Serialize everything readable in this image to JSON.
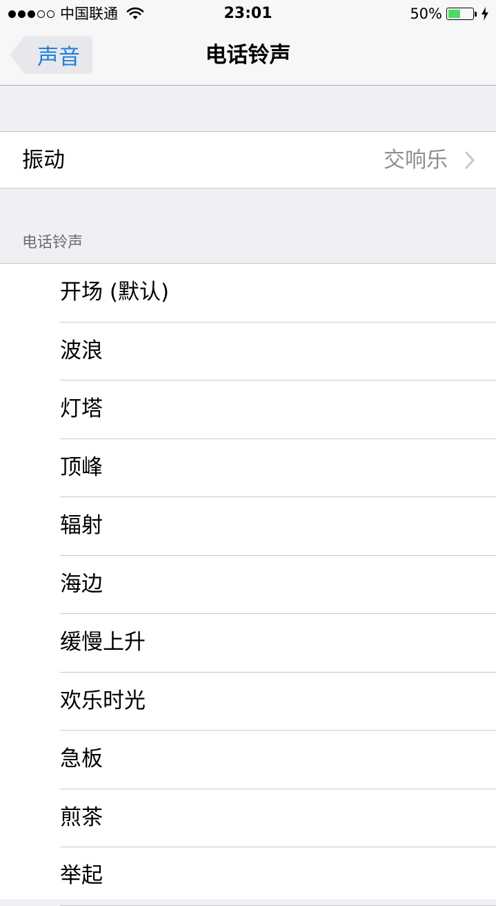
{
  "status_bar": {
    "carrier": "中国联通",
    "signal_bars_filled": 3,
    "signal_bars_total": 5,
    "time": "23:01",
    "battery_percent_text": "50%",
    "battery_level": 0.5,
    "battery_color": "#4cd964",
    "charging_icon": "bolt-icon"
  },
  "nav": {
    "back_label": "声音",
    "title": "电话铃声",
    "accent_color": "#1c7fe0"
  },
  "vibration": {
    "label": "振动",
    "value": "交响乐"
  },
  "ringtones": {
    "section_header": "电话铃声",
    "items": [
      {
        "label": "开场 (默认)"
      },
      {
        "label": "波浪"
      },
      {
        "label": "灯塔"
      },
      {
        "label": "顶峰"
      },
      {
        "label": "辐射"
      },
      {
        "label": "海边"
      },
      {
        "label": "缓慢上升"
      },
      {
        "label": "欢乐时光"
      },
      {
        "label": "急板"
      },
      {
        "label": "煎茶"
      },
      {
        "label": "举起"
      }
    ]
  }
}
